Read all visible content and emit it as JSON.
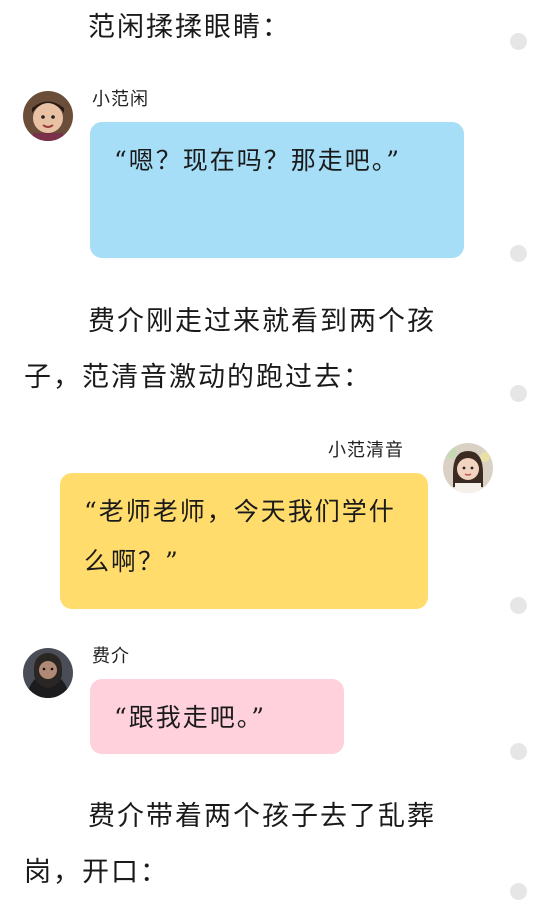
{
  "narration": [
    "范闲揉揉眼睛：",
    "费介刚走过来就看到两个孩子，范清音激动的跑过去：",
    "费介带着两个孩子去了乱葬岗，开口："
  ],
  "messages": [
    {
      "speaker": "小范闲",
      "text": "“嗯？现在吗？那走吧。”",
      "color": "#a6def8"
    },
    {
      "speaker": "小范清音",
      "text": "“老师老师，今天我们学什么啊？”",
      "color": "#ffdc6b"
    },
    {
      "speaker": "费介",
      "text": "“跟我走吧。”",
      "color": "#ffd1dd"
    }
  ],
  "icons": [
    "avatar-boy-icon",
    "avatar-girl-icon",
    "avatar-man-icon",
    "scroll-dot-icon"
  ]
}
